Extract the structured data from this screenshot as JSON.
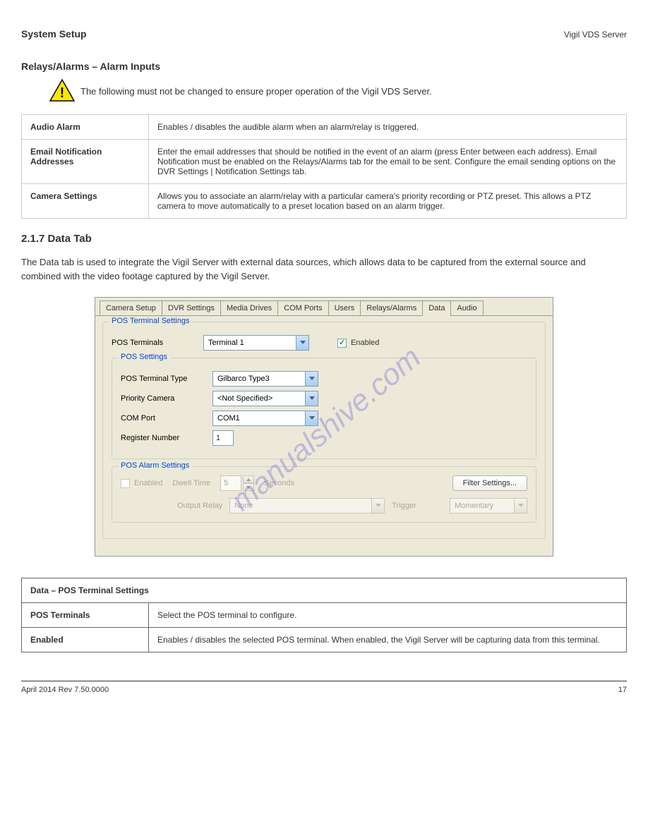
{
  "header": {
    "section": "System Setup",
    "product": "Vigil VDS Server"
  },
  "relays_section": {
    "title": "Relays/Alarms – Alarm Inputs",
    "warning": "The following must not be changed to ensure proper operation of the Vigil VDS Server.",
    "rows": [
      {
        "label": "Audio Alarm",
        "desc": "Enables / disables the audible alarm when an alarm/relay is triggered."
      },
      {
        "label": "Email Notification Addresses",
        "desc": "Enter the email addresses that should be notified in the event of an alarm (press Enter between each address). Email Notification must be enabled on the Relays/Alarms tab for the email to be sent. Configure the email sending options on the DVR Settings | Notification Settings tab."
      },
      {
        "label": "Camera Settings",
        "desc": "Allows you to associate an alarm/relay with a particular camera's priority recording or PTZ preset. This allows a PTZ camera to move automatically to a preset location based on an alarm trigger."
      }
    ]
  },
  "data_section": {
    "heading": "2.1.7 Data Tab",
    "intro": "The Data tab is used to integrate the Vigil Server with external data sources, which allows data to be captured from the external source and combined with the video footage captured by the Vigil Server."
  },
  "app": {
    "tabs": [
      "Camera Setup",
      "DVR Settings",
      "Media Drives",
      "COM Ports",
      "Users",
      "Relays/Alarms",
      "Data",
      "Audio"
    ],
    "active_tab": "Data",
    "group1_title": "POS Terminal Settings",
    "pos_terminals_label": "POS Terminals",
    "pos_terminals_value": "Terminal 1",
    "enabled_label": "Enabled",
    "group2_title": "POS Settings",
    "terminal_type_label": "POS Terminal Type",
    "terminal_type_value": "Gilbarco Type3",
    "priority_cam_label": "Priority Camera",
    "priority_cam_value": "<Not Specified>",
    "com_port_label": "COM Port",
    "com_port_value": "COM1",
    "register_label": "Register Number",
    "register_value": "1",
    "group3_title": "POS Alarm Settings",
    "alarm_enabled_label": "Enabled",
    "dwell_label": "Dwell Time",
    "dwell_value": "5",
    "dwell_unit": "Seconds",
    "filter_btn": "Filter Settings...",
    "output_relay_label": "Output Relay",
    "output_relay_value": "None",
    "trigger_label": "Trigger",
    "trigger_value": "Momentary"
  },
  "pos_table": {
    "title": "Data – POS Terminal Settings",
    "rows": [
      {
        "label": "POS Terminals",
        "desc": "Select the POS terminal to configure."
      },
      {
        "label": "Enabled",
        "desc": "Enables / disables the selected POS terminal. When enabled, the Vigil Server will be capturing data from this terminal."
      }
    ]
  },
  "footer": {
    "left": "April 2014 Rev 7.50.0000",
    "right": "17"
  },
  "watermark": "manualshive.com"
}
